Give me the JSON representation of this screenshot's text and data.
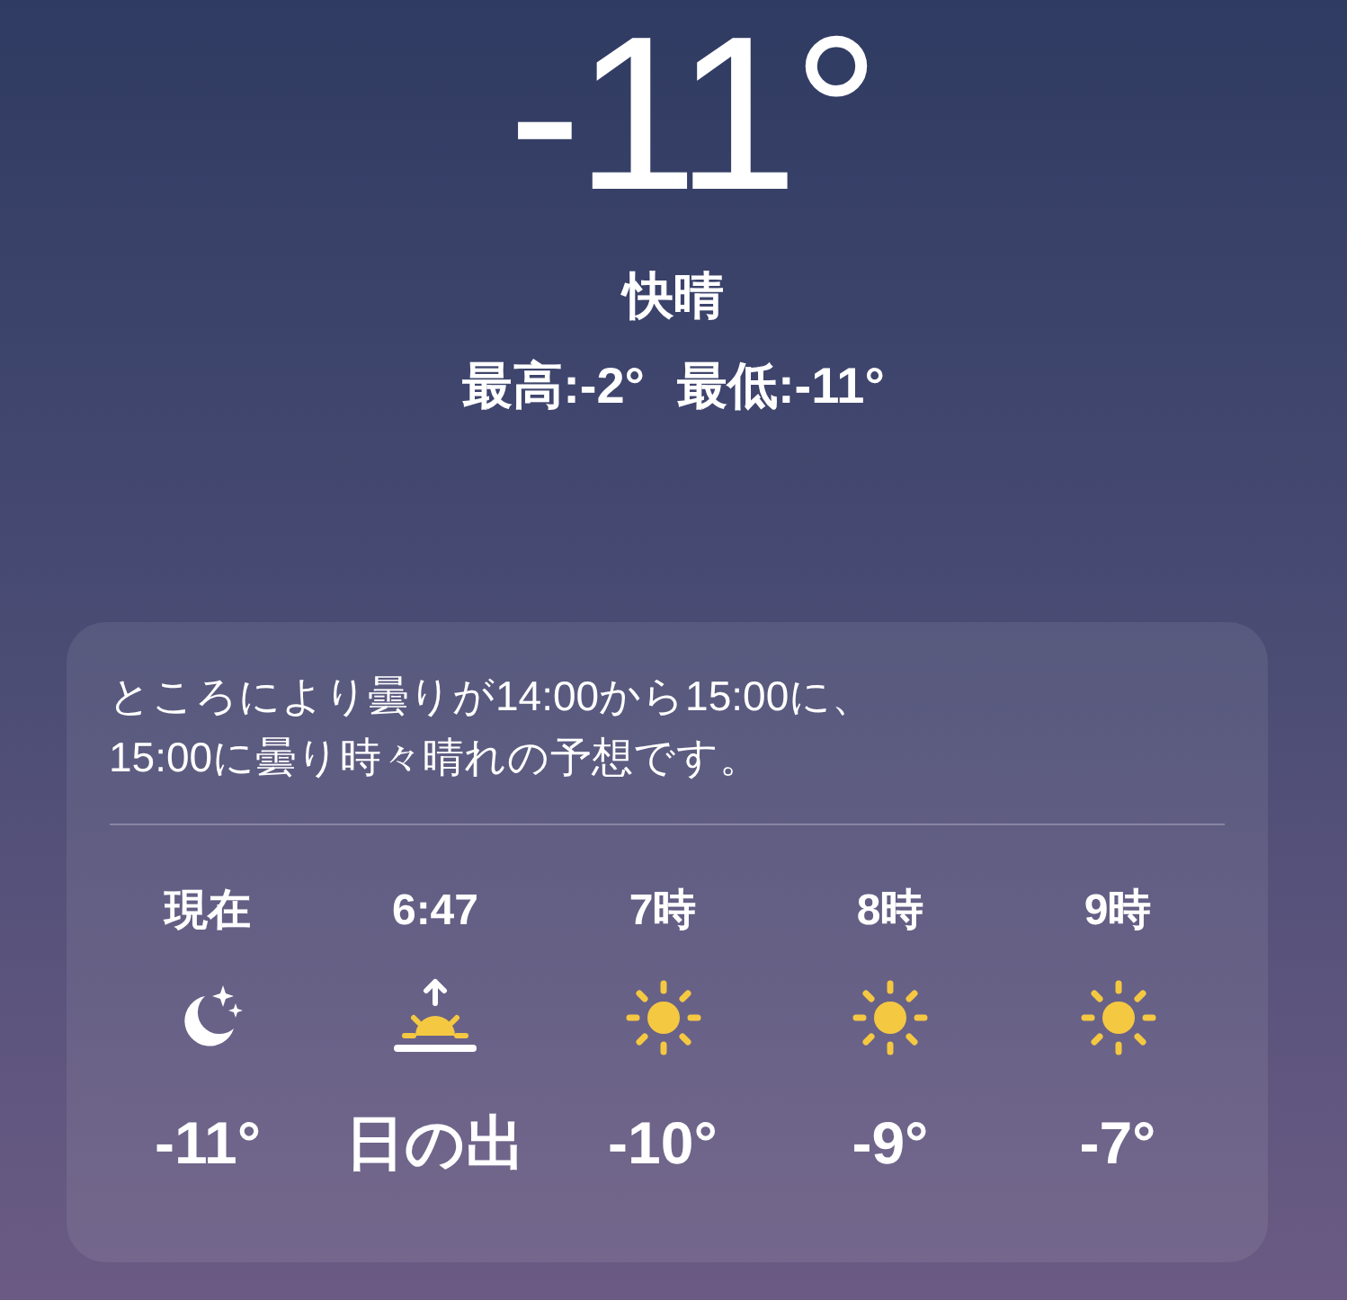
{
  "current": {
    "temperature": "-11°",
    "condition": "快晴",
    "high": "最高:-2°",
    "low": "最低:-11°"
  },
  "forecast_card": {
    "summary": "ところにより曇りが14:00から15:00に、15:00に曇り時々晴れの予想です。",
    "hours": [
      {
        "time": "現在",
        "kind": "moon",
        "value": "-11°"
      },
      {
        "time": "6:47",
        "kind": "sunrise",
        "value": "日の出"
      },
      {
        "time": "7時",
        "kind": "sun",
        "value": "-10°"
      },
      {
        "time": "8時",
        "kind": "sun",
        "value": "-9°"
      },
      {
        "time": "9時",
        "kind": "sun",
        "value": "-7°"
      }
    ]
  }
}
